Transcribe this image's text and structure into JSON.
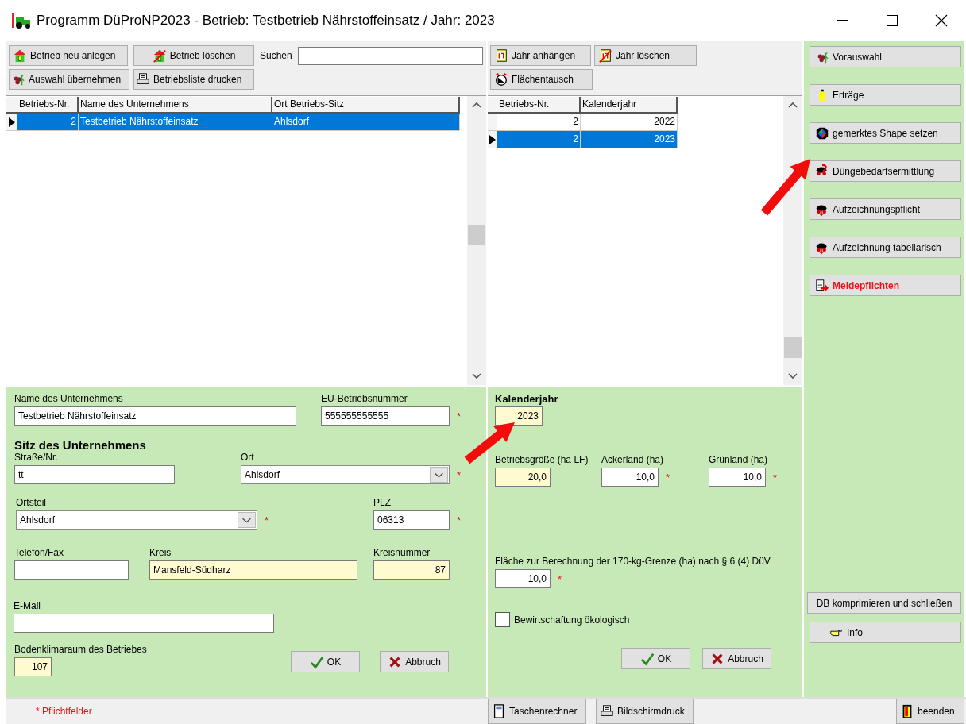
{
  "window": {
    "title": "Programm DüProNP2023 - Betrieb: Testbetrieb Nährstoffeinsatz / Jahr: 2023"
  },
  "company_toolbar": {
    "buttons": [
      "Betrieb neu anlegen",
      "Betrieb löschen",
      "Auswahl übernehmen",
      "Betriebsliste drucken"
    ],
    "search": {
      "label": "Suchen"
    }
  },
  "company_table": {
    "columns": [
      "Betriebs-Nr.",
      "Name des Unternehmens",
      "Ort Betriebs-Sitz"
    ],
    "rows": [
      {
        "cells": [
          "2",
          "Testbetrieb Nährstoffeinsatz",
          "Ahlsdorf"
        ],
        "selected": true
      }
    ]
  },
  "year_toolbar": {
    "buttons": [
      "Jahr anhängen",
      "Jahr löschen",
      "Flächentausch"
    ]
  },
  "year_table": {
    "columns": [
      "Betriebs-Nr.",
      "Kalenderjahr"
    ],
    "rows": [
      {
        "cells": [
          "2",
          "2022"
        ],
        "selected": false
      },
      {
        "cells": [
          "2",
          "2023"
        ],
        "selected": true
      }
    ]
  },
  "company_form": {
    "fields": {
      "name": {
        "kind": "text",
        "label": "Name des Unternehmens",
        "value": "Testbetrieb Nährstoffeinsatz",
        "highlighted": false
      },
      "eu_number": {
        "kind": "text",
        "label": "EU-Betriebsnummer",
        "value": "555555555555",
        "highlighted": false,
        "marker": "*"
      },
      "street": {
        "kind": "text",
        "label": "Straße/Nr.",
        "value": "tt",
        "highlighted": false
      },
      "ort": {
        "kind": "select",
        "label": "Ort",
        "value": "Ahlsdorf",
        "highlighted": false,
        "marker": "*"
      },
      "ortsteil": {
        "kind": "select",
        "label": "Ortsteil",
        "value": "Ahlsdorf",
        "highlighted": false,
        "marker": "*"
      },
      "plz": {
        "kind": "text",
        "label": "PLZ",
        "value": "06313",
        "highlighted": false,
        "marker": "*"
      },
      "phone": {
        "kind": "text",
        "label": "Telefon/Fax",
        "highlighted": false
      },
      "kreis": {
        "kind": "text",
        "label": "Kreis",
        "value": "Mansfeld-Südharz",
        "highlighted": true
      },
      "kreisnummer": {
        "kind": "text",
        "label": "Kreisnummer",
        "value": "87",
        "highlighted": true
      },
      "email": {
        "kind": "text",
        "label": "E-Mail",
        "highlighted": false
      },
      "bodenklimaraum": {
        "kind": "text",
        "label": "Bodenklimaraum des Betriebes",
        "value": "107",
        "highlighted": true
      }
    },
    "heading": "Sitz des Unternehmens",
    "buttons": [
      "OK",
      "Abbruch"
    ]
  },
  "year_form": {
    "fields": {
      "year": {
        "kind": "text",
        "label": "Kalenderjahr",
        "value": "2023",
        "highlighted": true
      },
      "size": {
        "kind": "text",
        "label": "Betriebsgröße (ha LF)",
        "value": "20,0",
        "highlighted": true
      },
      "arable": {
        "kind": "text",
        "label": "Ackerland (ha)",
        "value": "10,0",
        "highlighted": false,
        "marker": "*"
      },
      "grassland": {
        "kind": "text",
        "label": "Grünland (ha)",
        "value": "10,0",
        "highlighted": false,
        "marker": "*"
      },
      "area170": {
        "kind": "text",
        "label": "Fläche zur Berechnung der 170-kg-Grenze (ha) nach § 6 (4) DüV",
        "value": "10,0",
        "highlighted": false,
        "marker": "*"
      }
    },
    "organic": {
      "label": "Bewirtschaftung ökologisch",
      "checked": false
    },
    "buttons": [
      "OK",
      "Abbruch"
    ]
  },
  "sidebar": {
    "buttons": [
      {
        "label": "Vorauswahl",
        "emphasized": false
      },
      {
        "label": "Erträge",
        "emphasized": false
      },
      {
        "label": "gemerktes Shape setzen",
        "emphasized": false
      },
      {
        "label": "Düngebedarfsermittlung",
        "emphasized": false
      },
      {
        "label": "Aufzeichnungspflicht",
        "emphasized": false
      },
      {
        "label": "Aufzeichnung tabellarisch",
        "emphasized": false
      },
      {
        "label": "Meldepflichten",
        "emphasized": true
      }
    ],
    "bottom_buttons": [
      "DB komprimieren und schließen",
      "Info"
    ]
  },
  "status_bar": {
    "note": "* Pflichtfelder",
    "buttons": [
      "Taschenrechner",
      "Bildschirmdruck",
      "beenden"
    ]
  }
}
